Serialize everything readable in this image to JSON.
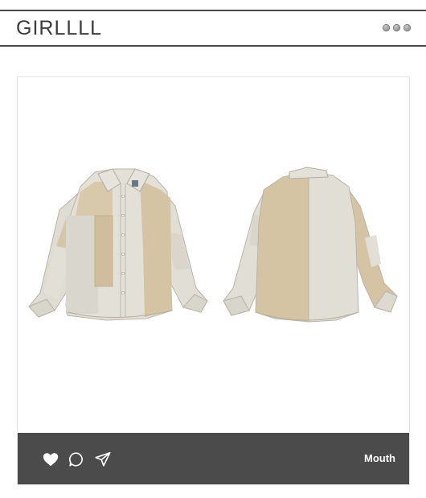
{
  "header": {
    "brand": "GIRLLLL",
    "menu_icon": "more-dots-icon"
  },
  "post": {
    "image_icon": "product-photo",
    "actions": {
      "like_icon": "heart-icon",
      "comment_icon": "comment-icon",
      "share_icon": "send-icon"
    },
    "username": "Mouth"
  },
  "colors": {
    "border": "#4a4a4a",
    "action_bar": "#4b4b4b",
    "beige": "#d6c6a8",
    "light_grey": "#dedbd3"
  }
}
